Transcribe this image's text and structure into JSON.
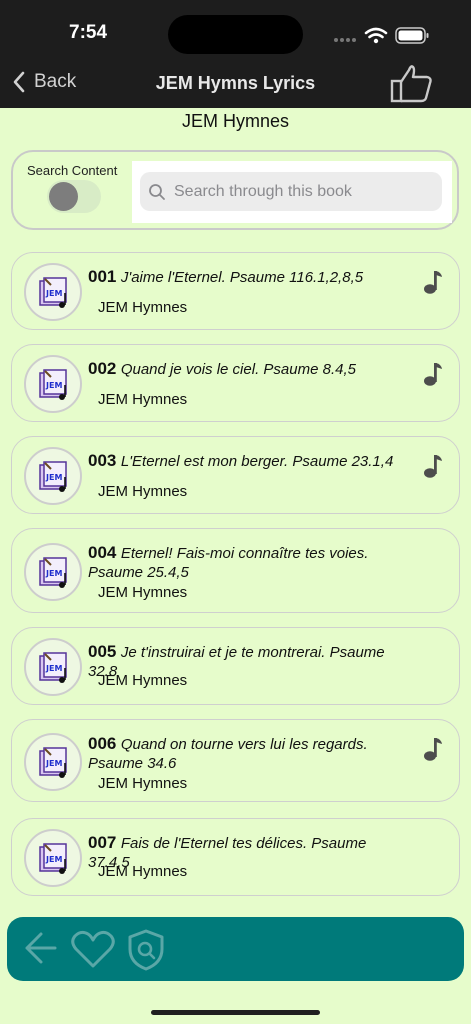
{
  "status_bar": {
    "time": "7:54"
  },
  "nav": {
    "back_label": "Back",
    "title": "JEM Hymns Lyrics"
  },
  "page": {
    "heading": "JEM Hymnes"
  },
  "search": {
    "toggle_label": "Search Content",
    "toggle_on": false,
    "placeholder": "Search through this book"
  },
  "hymns": [
    {
      "number": "001",
      "title": "J'aime l'Eternel. Psaume 116.1,2,8,5",
      "book": "JEM Hymnes",
      "has_audio": true
    },
    {
      "number": "002",
      "title": "Quand je vois le ciel. Psaume 8.4,5",
      "book": "JEM Hymnes",
      "has_audio": true
    },
    {
      "number": "003",
      "title": "L'Eternel est mon berger. Psaume 23.1,4",
      "book": "JEM Hymnes",
      "has_audio": true
    },
    {
      "number": "004",
      "title": "Eternel! Fais-moi connaître tes voies. Psaume 25.4,5",
      "book": "JEM Hymnes",
      "has_audio": false
    },
    {
      "number": "005",
      "title": "Je t'instruirai et je te montrerai. Psaume 32.8",
      "book": "JEM Hymnes",
      "has_audio": false
    },
    {
      "number": "006",
      "title": "Quand on tourne vers lui les regards. Psaume 34.6",
      "book": "JEM Hymnes",
      "has_audio": true
    },
    {
      "number": "007",
      "title": "Fais de l'Eternel tes délices. Psaume 37.4,5",
      "book": "JEM Hymnes",
      "has_audio": false
    }
  ],
  "icons": {
    "back": "chevron-left-icon",
    "like": "thumbs-up-icon",
    "search": "search-icon",
    "audio": "music-note-icon",
    "thumb": "hymn-book-icon",
    "bottom": [
      "arrow-left-icon",
      "heart-icon",
      "shield-search-icon"
    ]
  },
  "colors": {
    "background": "#e6fccb",
    "topbar": "#1d1d1d",
    "bottom_bar": "#007a7a",
    "accent_icon": "#555555"
  }
}
